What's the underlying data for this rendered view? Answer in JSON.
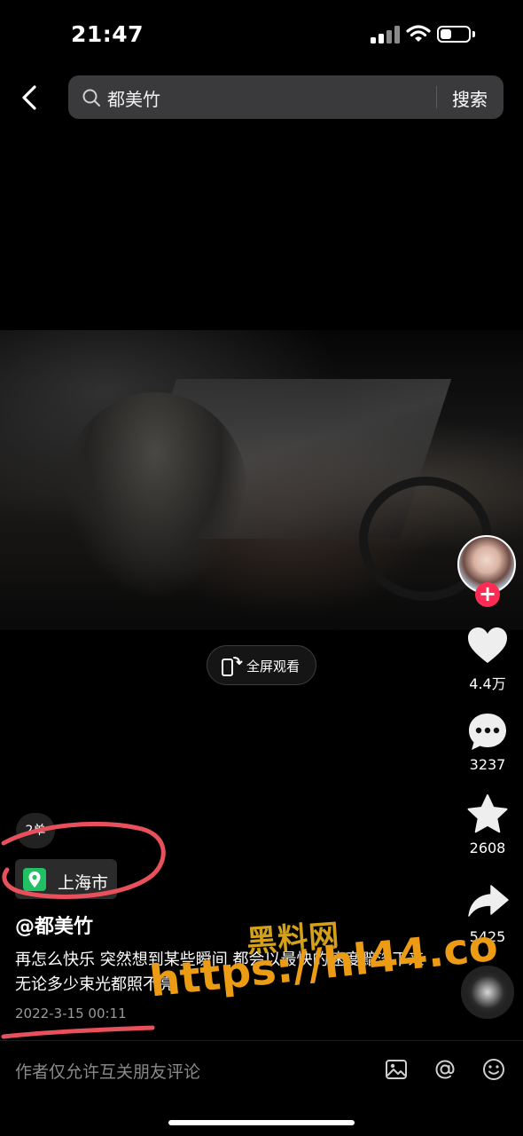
{
  "status_bar": {
    "time": "21:47",
    "battery_level": 0.4
  },
  "header": {
    "search_query": "都美竹",
    "search_button": "搜索"
  },
  "video": {
    "fullscreen_label": "全屏观看"
  },
  "actions": {
    "likes": "4.4万",
    "comments": "3237",
    "favorites": "2608",
    "shares": "5425"
  },
  "post": {
    "tag_chip": "2单",
    "location": "上海市",
    "author": "@都美竹",
    "caption": "再怎么快乐 突然想到某些瞬间 都会以最快的速度黯淡下来 无论多少束光都照不亮",
    "date": "2022-3-15 00:11"
  },
  "comment_bar": {
    "placeholder": "作者仅允许互关朋友评论"
  },
  "watermark": {
    "line1": "黑料网",
    "line2": "https://hl44.co"
  },
  "colors": {
    "follow_badge": "#fe2c55",
    "location_icon": "#21c064",
    "annotation": "#e8505b",
    "watermark": "#ec9c14"
  }
}
